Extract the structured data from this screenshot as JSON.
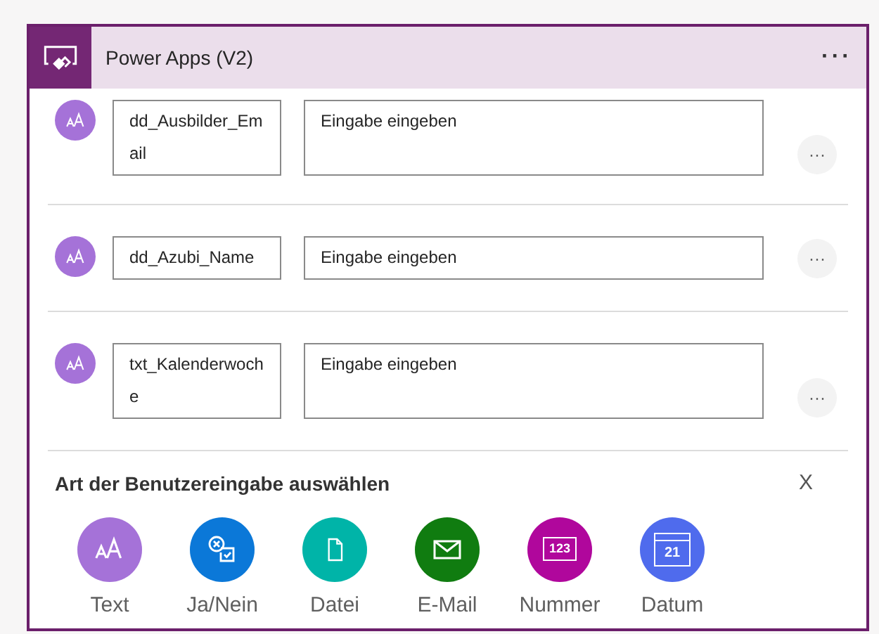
{
  "header": {
    "title": "Power Apps (V2)",
    "menu": "···"
  },
  "inputs": [
    {
      "name": "dd_Ausbilder_Email",
      "placeholder": "Eingabe eingeben",
      "more": "···"
    },
    {
      "name": "dd_Azubi_Name",
      "placeholder": "Eingabe eingeben",
      "more": "···"
    },
    {
      "name": "txt_Kalenderwoche",
      "placeholder": "Eingabe eingeben",
      "more": "···"
    }
  ],
  "picker": {
    "title": "Art der Benutzereingabe auswählen",
    "close": "X",
    "types": [
      {
        "kind": "text",
        "label": "Text",
        "color": "#a572d8"
      },
      {
        "kind": "yesno",
        "label": "Ja/Nein",
        "color": "#0b78d8"
      },
      {
        "kind": "file",
        "label": "Datei",
        "color": "#00b4a8"
      },
      {
        "kind": "email",
        "label": "E-Mail",
        "color": "#107c10"
      },
      {
        "kind": "number",
        "label": "Nummer",
        "color": "#b0079c",
        "glyph": "123"
      },
      {
        "kind": "date",
        "label": "Datum",
        "color": "#4f6bed",
        "glyph": "21"
      }
    ]
  }
}
